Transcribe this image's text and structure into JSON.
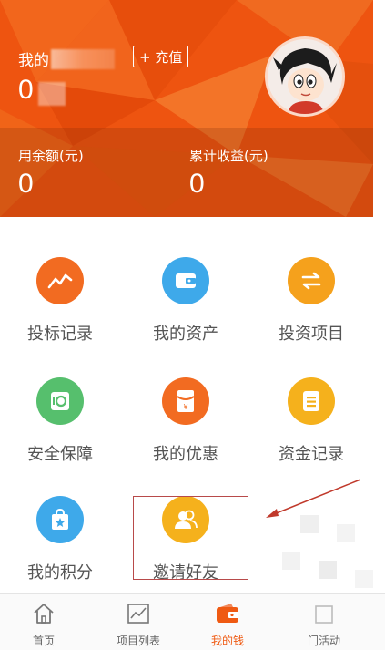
{
  "header": {
    "title_prefix": "我的",
    "recharge_label": "+ 充值",
    "balance": "0",
    "stats": [
      {
        "label": "用余额(元)",
        "value": "0"
      },
      {
        "label": "累计收益(元)",
        "value": "0"
      }
    ]
  },
  "grid": [
    {
      "label": "投标记录",
      "icon": "trend-chart-icon",
      "color": "#f26b21"
    },
    {
      "label": "我的资产",
      "icon": "wallet-icon",
      "color": "#3ea9ea"
    },
    {
      "label": "投资项目",
      "icon": "exchange-arrows-icon",
      "color": "#f5a11c"
    },
    {
      "label": "安全保障",
      "icon": "safe-box-icon",
      "color": "#56bf6d"
    },
    {
      "label": "我的优惠",
      "icon": "red-envelope-icon",
      "color": "#f26b21"
    },
    {
      "label": "资金记录",
      "icon": "document-list-icon",
      "color": "#f5b11c"
    },
    {
      "label": "我的积分",
      "icon": "shopping-bag-star-icon",
      "color": "#3ea9ea"
    },
    {
      "label": "邀请好友",
      "icon": "friends-icon",
      "color": "#f5b11c"
    }
  ],
  "nav": [
    {
      "label": "首页",
      "icon": "home-icon"
    },
    {
      "label": "项目列表",
      "icon": "line-chart-icon"
    },
    {
      "label": "我的钱",
      "icon": "wallet-icon"
    },
    {
      "label": "门活动",
      "icon": "activity-icon"
    }
  ],
  "colors": {
    "brand": "#ef5a12",
    "highlight_border": "#b84a4a"
  }
}
